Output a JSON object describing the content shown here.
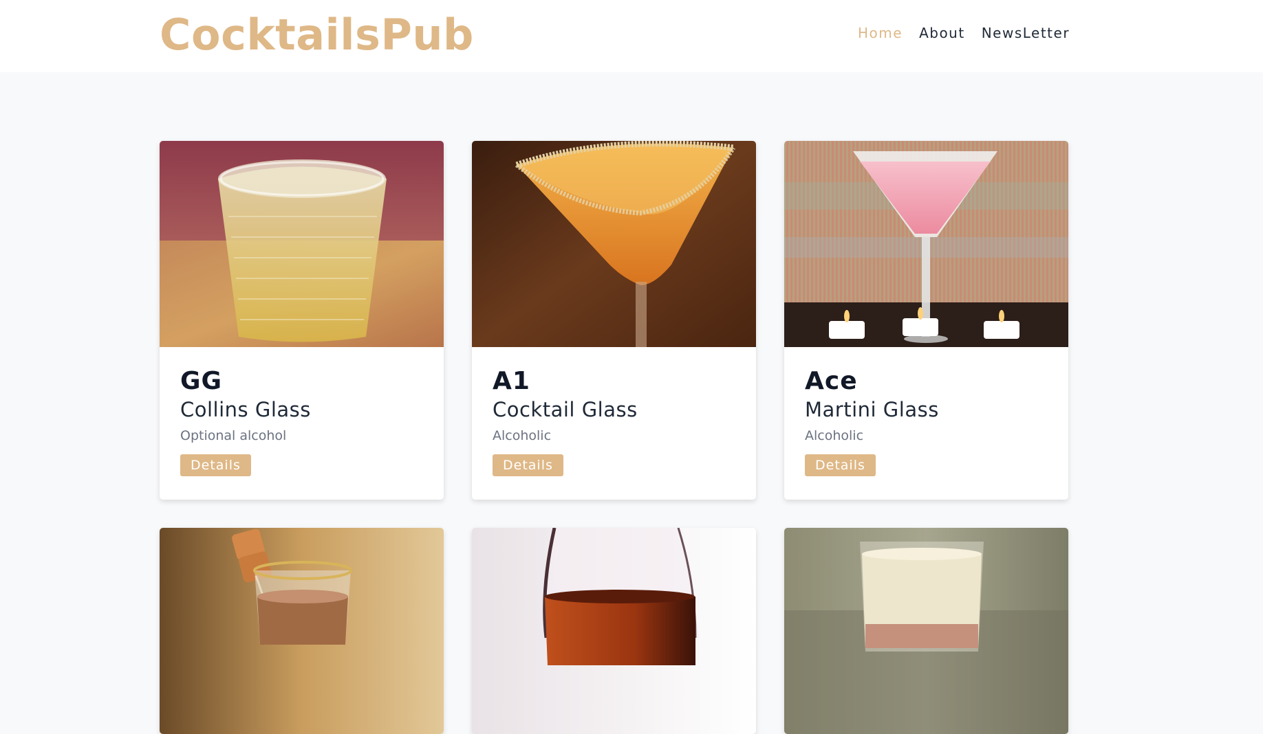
{
  "brand": "CocktailsPub",
  "nav": [
    {
      "label": "Home",
      "active": true
    },
    {
      "label": "About",
      "active": false
    },
    {
      "label": "NewsLetter",
      "active": false
    }
  ],
  "cards": [
    {
      "name": "GG",
      "glass": "Collins Glass",
      "alcoholic": "Optional alcohol",
      "button": "Details",
      "image": "yellow-drink-in-glass-tumbler"
    },
    {
      "name": "A1",
      "glass": "Cocktail Glass",
      "alcoholic": "Alcoholic",
      "button": "Details",
      "image": "orange-cocktail-sugar-rim"
    },
    {
      "name": "Ace",
      "glass": "Martini Glass",
      "alcoholic": "Alcoholic",
      "button": "Details",
      "image": "pink-martini-with-candles"
    },
    {
      "image": "caramel-shot-glass"
    },
    {
      "image": "amber-drink-in-wine-glass"
    },
    {
      "image": "creamy-drink-in-glass"
    }
  ],
  "colors": {
    "accent": "#dfb887",
    "background": "#f8f9fb"
  }
}
